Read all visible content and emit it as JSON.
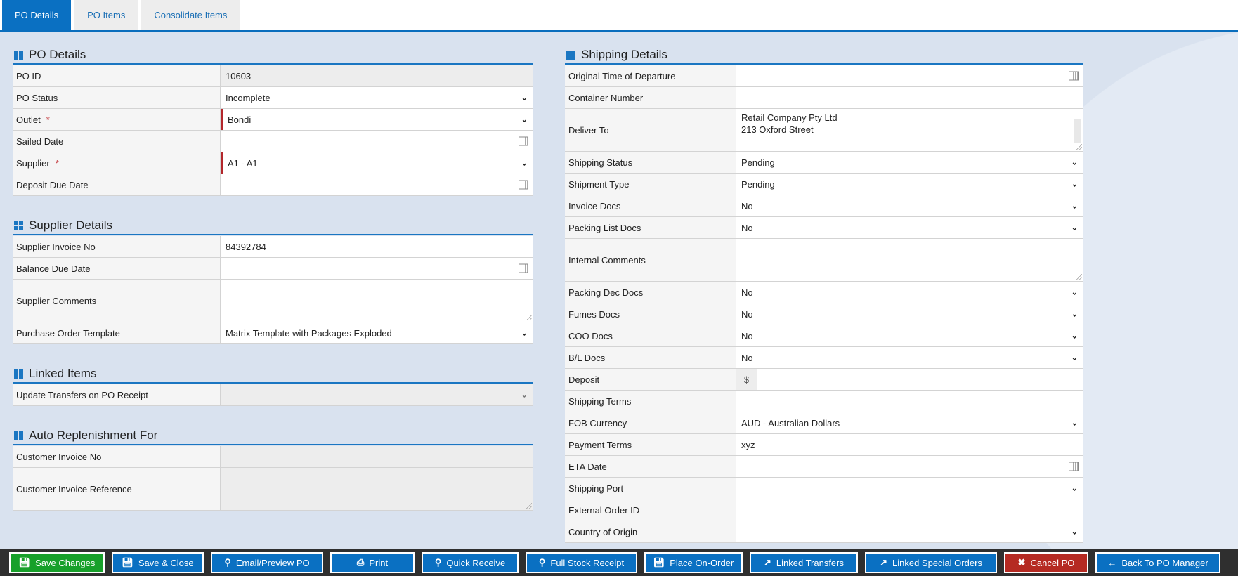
{
  "tabs": [
    {
      "label": "PO Details",
      "active": true
    },
    {
      "label": "PO Items"
    },
    {
      "label": "Consolidate Items"
    }
  ],
  "po_details": {
    "title": "PO Details",
    "po_id_label": "PO ID",
    "po_id": "10603",
    "status_label": "PO Status",
    "status": "Incomplete",
    "outlet_label": "Outlet",
    "outlet": "Bondi",
    "sailed_label": "Sailed Date",
    "supplier_label": "Supplier",
    "supplier": "A1 - A1",
    "deposit_due_label": "Deposit Due Date",
    "required_mark": "*"
  },
  "supplier_details": {
    "title": "Supplier Details",
    "invoice_label": "Supplier Invoice No",
    "invoice": "84392784",
    "balance_label": "Balance Due Date",
    "comments_label": "Supplier Comments",
    "template_label": "Purchase Order Template",
    "template": "Matrix Template with Packages Exploded"
  },
  "linked_items": {
    "title": "Linked Items",
    "update_label": "Update Transfers on PO Receipt"
  },
  "auto_replenishment": {
    "title": "Auto Replenishment For",
    "cust_invoice_label": "Customer Invoice No",
    "cust_ref_label": "Customer Invoice Reference"
  },
  "shipping": {
    "title": "Shipping Details",
    "otd_label": "Original Time of Departure",
    "container_label": "Container Number",
    "deliver_label": "Deliver To",
    "deliver_line1": "Retail Company Pty Ltd",
    "deliver_line2": "213 Oxford Street",
    "ship_status_label": "Shipping Status",
    "ship_status": "Pending",
    "ship_type_label": "Shipment Type",
    "ship_type": "Pending",
    "invoice_docs_label": "Invoice Docs",
    "invoice_docs": "No",
    "packing_list_label": "Packing List Docs",
    "packing_list": "No",
    "internal_label": "Internal Comments",
    "packing_dec_label": "Packing Dec Docs",
    "packing_dec": "No",
    "fumes_label": "Fumes Docs",
    "fumes": "No",
    "coo_label": "COO Docs",
    "coo": "No",
    "bl_label": "B/L Docs",
    "bl": "No",
    "deposit_label": "Deposit",
    "currency_symbol": "$",
    "terms_label": "Shipping Terms",
    "fob_label": "FOB Currency",
    "fob": "AUD - Australian Dollars",
    "payment_label": "Payment Terms",
    "payment": "xyz",
    "eta_label": "ETA Date",
    "port_label": "Shipping Port",
    "ext_label": "External Order ID",
    "origin_label": "Country of Origin"
  },
  "toolbar": {
    "save": "Save Changes",
    "save_close": "Save & Close",
    "email": "Email/Preview PO",
    "print": "Print",
    "quick": "Quick Receive",
    "full": "Full Stock Receipt",
    "onorder": "Place On-Order",
    "transfers": "Linked Transfers",
    "special": "Linked Special Orders",
    "cancel": "Cancel PO",
    "back": "Back To PO Manager"
  },
  "colors": {
    "accent": "#0a70c2",
    "save": "#17a02a",
    "cancel": "#b52a22"
  }
}
